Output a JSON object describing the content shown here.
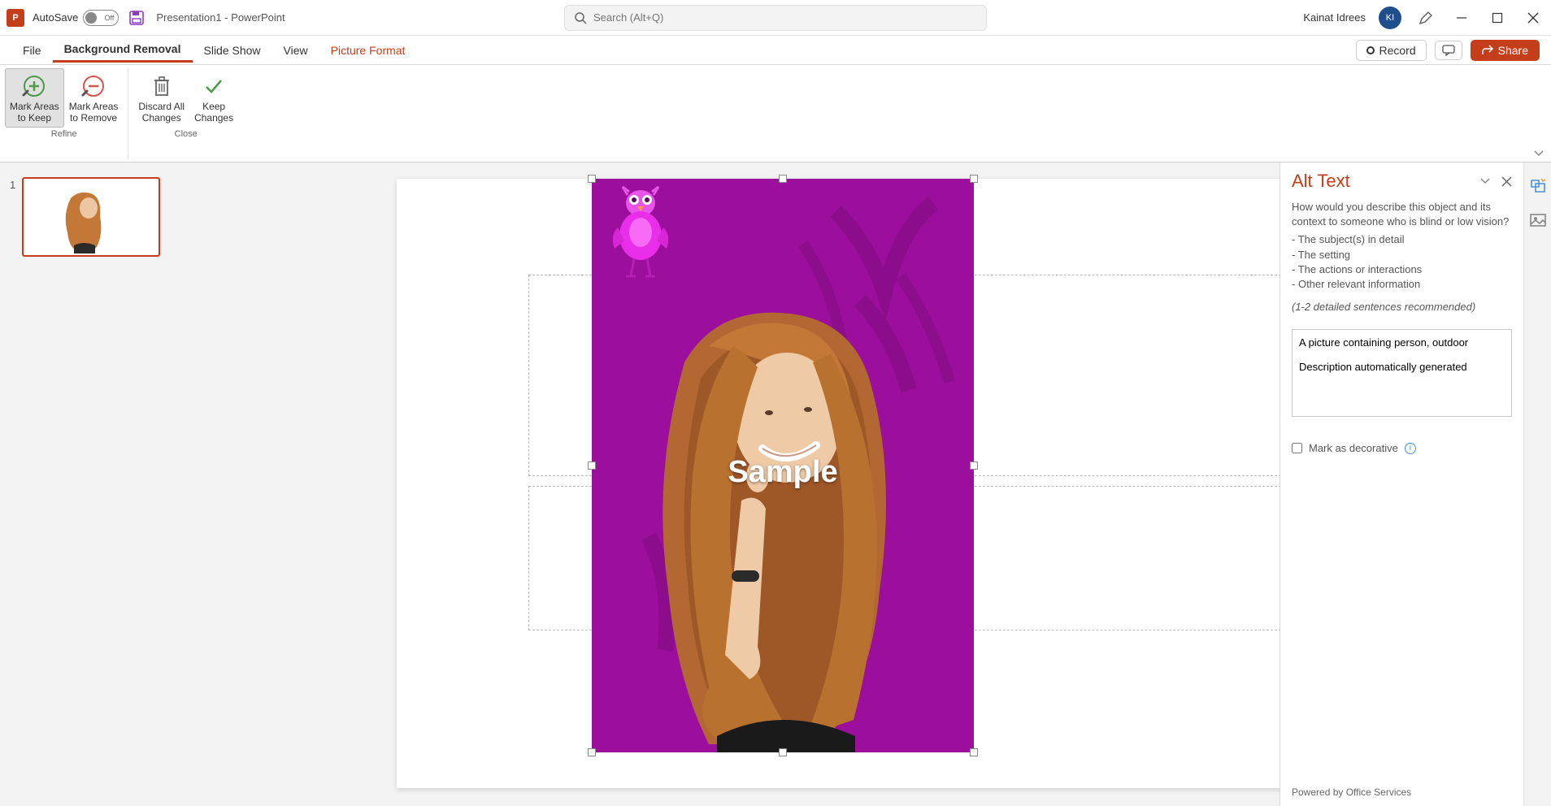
{
  "titlebar": {
    "app_initial": "P",
    "autosave_label": "AutoSave",
    "autosave_state": "Off",
    "doc_title": "Presentation1 - PowerPoint",
    "search_placeholder": "Search (Alt+Q)",
    "user_name": "Kainat Idrees",
    "user_initials": "KI"
  },
  "tabs": {
    "file": "File",
    "bgremoval": "Background Removal",
    "slideshow": "Slide Show",
    "view": "View",
    "picformat": "Picture Format",
    "record": "Record",
    "share": "Share"
  },
  "ribbon": {
    "mark_keep": "Mark Areas\nto Keep",
    "mark_remove": "Mark Areas\nto Remove",
    "discard": "Discard All\nChanges",
    "keep": "Keep\nChanges",
    "group_refine": "Refine",
    "group_close": "Close"
  },
  "thumb": {
    "num": "1"
  },
  "picture": {
    "watermark": "Sample"
  },
  "alt": {
    "title": "Alt Text",
    "q": "How would you describe this object and its context to someone who is blind or low vision?",
    "b1": "The subject(s) in detail",
    "b2": "The setting",
    "b3": "The actions or interactions",
    "b4": "Other relevant information",
    "hint": "(1-2 detailed sentences recommended)",
    "textarea": "A picture containing person, outdoor\n\nDescription automatically generated",
    "decorative": "Mark as decorative",
    "footer": "Powered by Office Services"
  }
}
